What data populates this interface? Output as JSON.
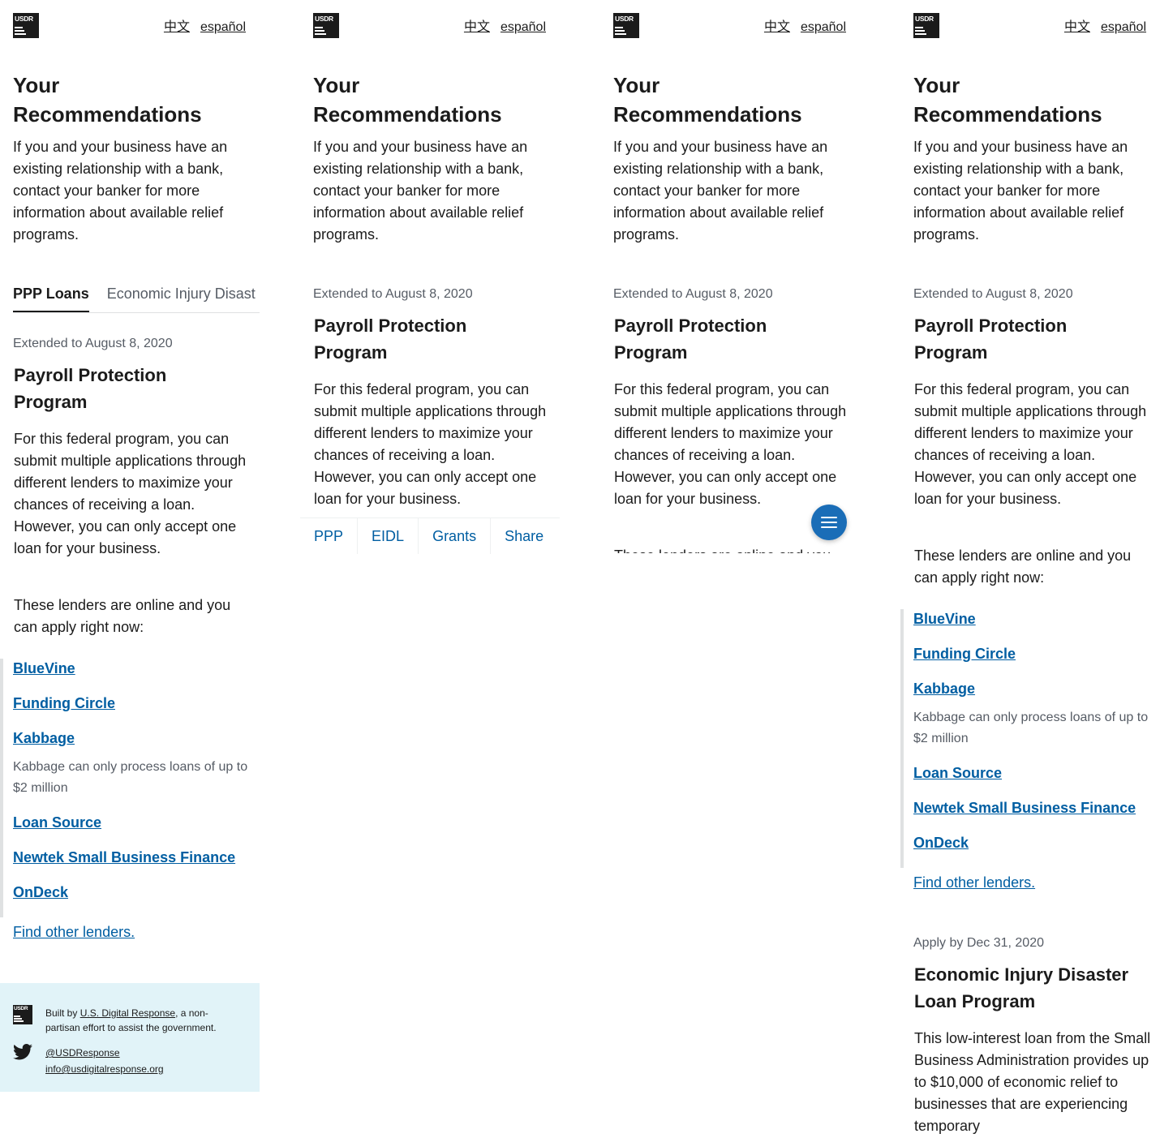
{
  "logo_text": "USDR",
  "header": {
    "lang_chinese": "中文",
    "lang_spanish": "español"
  },
  "page_title": "Your Recommendations",
  "intro": "If you and your business have an existing relationship with a bank, contact your banker for more information about available relief programs.",
  "tabs": [
    "PPP Loans",
    "Economic Injury Disast"
  ],
  "ppp": {
    "date": "Extended to August 8, 2020",
    "title": "Payroll Protection Program",
    "body": "For this federal program, you can submit multiple applications through different lenders to maximize your chances of receiving a loan. However, you can only accept one loan for your business.",
    "lenders_intro": "These lenders are online and you can apply right now:",
    "lenders": [
      "BlueVine",
      "Funding Circle",
      "Kabbage",
      "Loan Source",
      "Newtek Small Business Finance",
      "OnDeck"
    ],
    "kabbage_note": "Kabbage can only process loans of up to $2 million",
    "find_other": "Find other lenders."
  },
  "eidl": {
    "date": "Apply by Dec 31, 2020",
    "title": "Economic Injury Disaster Loan Program",
    "body": "This low-interest loan from the Small Business Administration provides up to $10,000 of economic relief to businesses that are experiencing temporary"
  },
  "footer": {
    "built_by_prefix": "Built by ",
    "built_by_link": "U.S. Digital Response",
    "built_by_suffix": ", a non-partisan effort to assist the government.",
    "twitter": "@USDResponse",
    "email": "info@usdigitalresponse.org"
  },
  "bottom_nav": [
    "PPP",
    "EIDL",
    "Grants",
    "Share"
  ],
  "colors": {
    "link": "#005ea2",
    "footer_bg": "#e1f3f8",
    "fab": "#1a6db7",
    "text": "#1b1b1b",
    "muted": "#565c65"
  },
  "icons": {
    "menu_fab": "hamburger-icon",
    "twitter": "twitter-bird-icon"
  }
}
